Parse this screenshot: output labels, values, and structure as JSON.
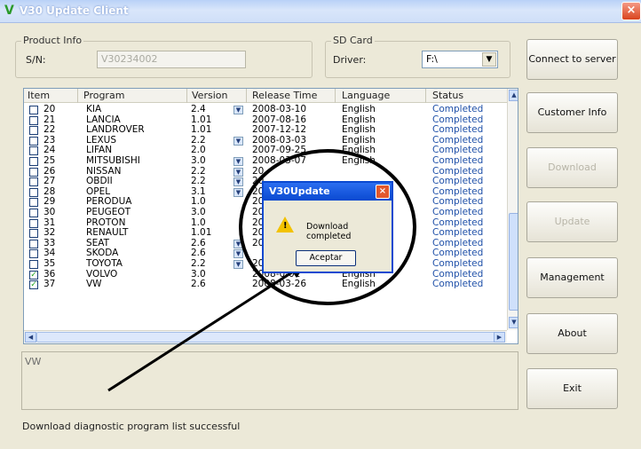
{
  "window": {
    "title": "V30 Update Client",
    "close_glyph": "×",
    "icon": "v-logo-icon"
  },
  "product_info": {
    "legend": "Product Info",
    "sn_label": "S/N:",
    "sn_value": "V30234002"
  },
  "sd_card": {
    "legend": "SD Card",
    "driver_label": "Driver:",
    "driver_value": "F:\\"
  },
  "side_buttons": {
    "connect": "Connect to server",
    "customer_info": "Customer Info",
    "download": "Download",
    "update": "Update",
    "management": "Management",
    "about": "About",
    "exit": "Exit"
  },
  "table": {
    "headers": [
      "Item",
      "Program",
      "Version",
      "Release Time",
      "Language",
      "Status"
    ],
    "rows": [
      {
        "item": "20",
        "program": "KIA",
        "version": "2.4",
        "release": "2008-03-10",
        "language": "English",
        "status": "Completed",
        "checked": false,
        "dropdown": true
      },
      {
        "item": "21",
        "program": "LANCIA",
        "version": "1.01",
        "release": "2007-08-16",
        "language": "English",
        "status": "Completed",
        "checked": false,
        "dropdown": false
      },
      {
        "item": "22",
        "program": "LANDROVER",
        "version": "1.01",
        "release": "2007-12-12",
        "language": "English",
        "status": "Completed",
        "checked": false,
        "dropdown": false
      },
      {
        "item": "23",
        "program": "LEXUS",
        "version": "2.2",
        "release": "2008-03-03",
        "language": "English",
        "status": "Completed",
        "checked": false,
        "dropdown": true
      },
      {
        "item": "24",
        "program": "LIFAN",
        "version": "2.0",
        "release": "2007-09-25",
        "language": "English",
        "status": "Completed",
        "checked": false,
        "dropdown": false
      },
      {
        "item": "25",
        "program": "MITSUBISHI",
        "version": "3.0",
        "release": "2008-03-07",
        "language": "English",
        "status": "Completed",
        "checked": false,
        "dropdown": true
      },
      {
        "item": "26",
        "program": "NISSAN",
        "version": "2.2",
        "release": "20",
        "language": "",
        "status": "Completed",
        "checked": false,
        "dropdown": true
      },
      {
        "item": "27",
        "program": "OBDII",
        "version": "2.2",
        "release": "20",
        "language": "",
        "status": "Completed",
        "checked": false,
        "dropdown": true
      },
      {
        "item": "28",
        "program": "OPEL",
        "version": "3.1",
        "release": "20",
        "language": "",
        "status": "Completed",
        "checked": false,
        "dropdown": true
      },
      {
        "item": "29",
        "program": "PERODUA",
        "version": "1.0",
        "release": "20",
        "language": "",
        "status": "Completed",
        "checked": false,
        "dropdown": false
      },
      {
        "item": "30",
        "program": "PEUGEOT",
        "version": "3.0",
        "release": "20",
        "language": "",
        "status": "Completed",
        "checked": false,
        "dropdown": false
      },
      {
        "item": "31",
        "program": "PROTON",
        "version": "1.0",
        "release": "20",
        "language": "",
        "status": "Completed",
        "checked": false,
        "dropdown": false
      },
      {
        "item": "32",
        "program": "RENAULT",
        "version": "1.01",
        "release": "20",
        "language": "",
        "status": "Completed",
        "checked": false,
        "dropdown": false
      },
      {
        "item": "33",
        "program": "SEAT",
        "version": "2.6",
        "release": "20",
        "language": "",
        "status": "Completed",
        "checked": false,
        "dropdown": true
      },
      {
        "item": "34",
        "program": "SKODA",
        "version": "2.6",
        "release": "",
        "language": "English",
        "status": "Completed",
        "checked": false,
        "dropdown": true
      },
      {
        "item": "35",
        "program": "TOYOTA",
        "version": "2.2",
        "release": "2008-03",
        "language": "English",
        "status": "Completed",
        "checked": false,
        "dropdown": true
      },
      {
        "item": "36",
        "program": "VOLVO",
        "version": "3.0",
        "release": "2008-0-01",
        "language": "English",
        "status": "Completed",
        "checked": true,
        "dropdown": false
      },
      {
        "item": "37",
        "program": "VW",
        "version": "2.6",
        "release": "2008-03-26",
        "language": "English",
        "status": "Completed",
        "checked": true,
        "dropdown": false
      }
    ]
  },
  "description": {
    "text": "VW"
  },
  "status_bar": {
    "text": "Download diagnostic program list successful"
  },
  "dialog": {
    "title": "V30Update",
    "message": "Download completed",
    "ok_label": "Aceptar",
    "close_glyph": "×",
    "icon": "warning-icon"
  },
  "colors": {
    "accent": "#0a49d0",
    "status_text": "#1f50a8",
    "annotation": "#000000"
  }
}
